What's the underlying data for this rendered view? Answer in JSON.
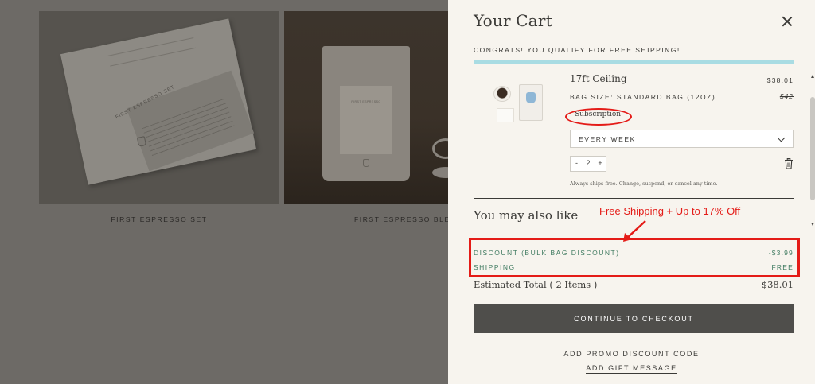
{
  "background_page": {
    "products": [
      {
        "name": "FIRST ESPRESSO SET",
        "box_title": "FIRST ESPRESSO SET"
      },
      {
        "name": "FIRST ESPRESSO BLEN",
        "bag_label": "FIRST ESPRESSO"
      }
    ]
  },
  "cart": {
    "title": "Your Cart",
    "free_shipping_message": "CONGRATS! YOU QUALIFY FOR FREE SHIPPING!",
    "free_shipping_progress": 1.0,
    "item": {
      "name": "17ft Ceiling",
      "price": "$38.01",
      "variant": "BAG SIZE: STANDARD BAG (12OZ)",
      "compare_price": "$42",
      "badge": "Subscription",
      "frequency": "EVERY WEEK",
      "quantity": "2",
      "qty_minus": "-",
      "qty_plus": "+",
      "note": "Always ships free. Change, suspend, or cancel any time."
    },
    "also_like_heading": "You may also like",
    "summary": {
      "discount_label": "DISCOUNT (BULK BAG DISCOUNT)",
      "discount_value": "-$3.99",
      "shipping_label": "SHIPPING",
      "shipping_value": "FREE",
      "total_label": "Estimated Total ( 2 Items )",
      "total_value": "$38.01"
    },
    "checkout_label": "CONTINUE TO CHECKOUT",
    "promo_link": "ADD PROMO DISCOUNT CODE",
    "gift_link": "ADD GIFT MESSAGE"
  },
  "annotations": {
    "callout_text": "Free Shipping + Up to 17% Off",
    "highlight_color": "#e41b17"
  },
  "icons": [
    "close-icon",
    "chevron-down-icon",
    "trash-icon",
    "callout-arrow-icon"
  ],
  "colors": {
    "drawer_bg": "#f7f4ee",
    "progress_fill": "#a9dce3",
    "summary_text": "#3f7a60",
    "checkout_bg": "#4f4e4b",
    "overlay_dim": "#6d6a66"
  }
}
